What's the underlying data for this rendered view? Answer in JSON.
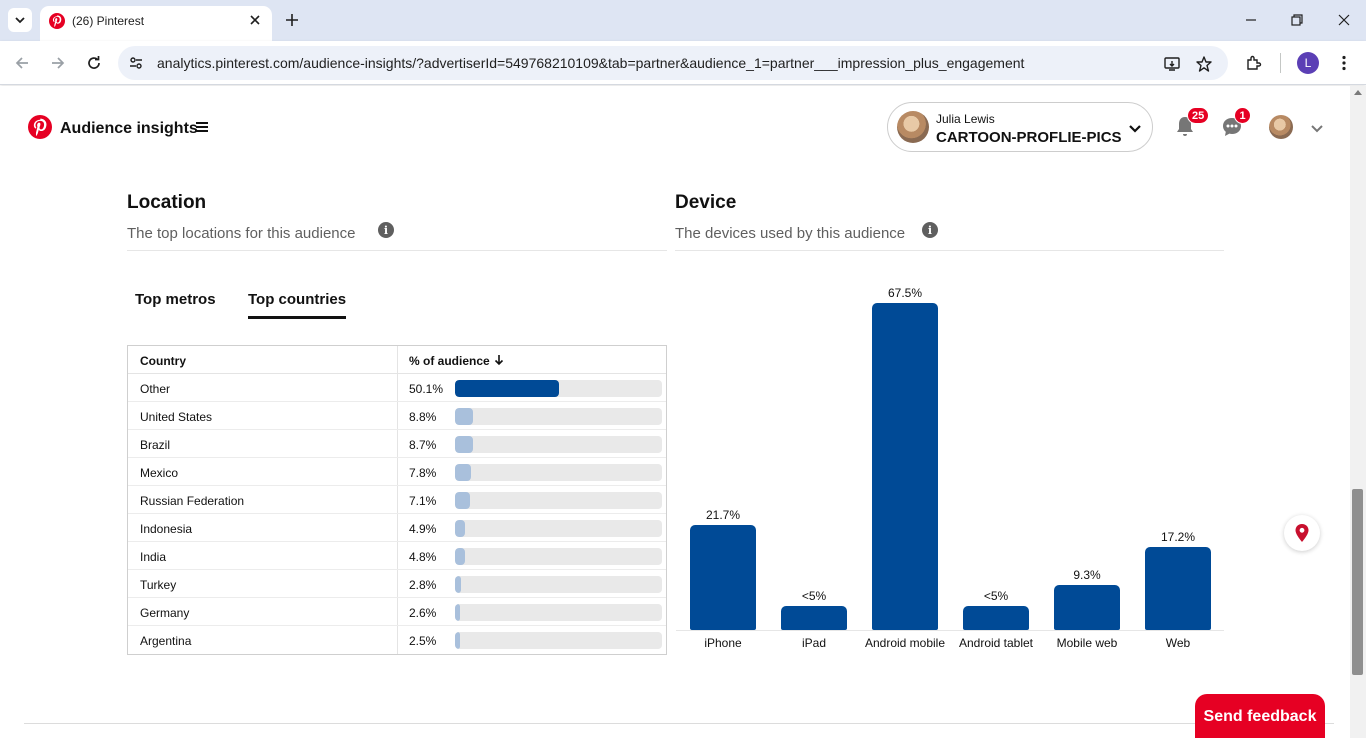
{
  "browser": {
    "tab_title": "(26) Pinterest",
    "url": "analytics.pinterest.com/audience-insights/?advertiserId=549768210109&tab=partner&audience_1=partner___impression_plus_engagement",
    "profile_initial": "L"
  },
  "header": {
    "app_title": "Audience insights",
    "account_name": "Julia Lewis",
    "account_handle": "CARTOON-PROFLIE-PICS",
    "notifications_count": "25",
    "messages_count": "1"
  },
  "location": {
    "title": "Location",
    "subtitle": "The top locations for this audience",
    "tabs": [
      "Top metros",
      "Top countries"
    ],
    "active_tab": "Top countries",
    "table": {
      "col_country": "Country",
      "col_pct": "% of audience",
      "rows": [
        {
          "country": "Other",
          "pct": "50.1%",
          "value": 50.1
        },
        {
          "country": "United States",
          "pct": "8.8%",
          "value": 8.8
        },
        {
          "country": "Brazil",
          "pct": "8.7%",
          "value": 8.7
        },
        {
          "country": "Mexico",
          "pct": "7.8%",
          "value": 7.8
        },
        {
          "country": "Russian Federation",
          "pct": "7.1%",
          "value": 7.1
        },
        {
          "country": "Indonesia",
          "pct": "4.9%",
          "value": 4.9
        },
        {
          "country": "India",
          "pct": "4.8%",
          "value": 4.8
        },
        {
          "country": "Turkey",
          "pct": "2.8%",
          "value": 2.8
        },
        {
          "country": "Germany",
          "pct": "2.6%",
          "value": 2.6
        },
        {
          "country": "Argentina",
          "pct": "2.5%",
          "value": 2.5
        }
      ]
    }
  },
  "device": {
    "title": "Device",
    "subtitle": "The devices used by this audience"
  },
  "chart_data": {
    "type": "bar",
    "categories": [
      "iPhone",
      "iPad",
      "Android mobile",
      "Android tablet",
      "Mobile web",
      "Web"
    ],
    "values": [
      21.7,
      4,
      67.5,
      4,
      9.3,
      17.2
    ],
    "labels": [
      "21.7%",
      "<5%",
      "67.5%",
      "<5%",
      "9.3%",
      "17.2%"
    ],
    "ylim": [
      0,
      67.5
    ],
    "grid": false,
    "color": "#004a96"
  },
  "footer": {
    "feedback_label": "Send feedback"
  },
  "colors": {
    "brand": "#e60023",
    "bar": "#004a96",
    "bar_light": "#a9c0dc"
  }
}
